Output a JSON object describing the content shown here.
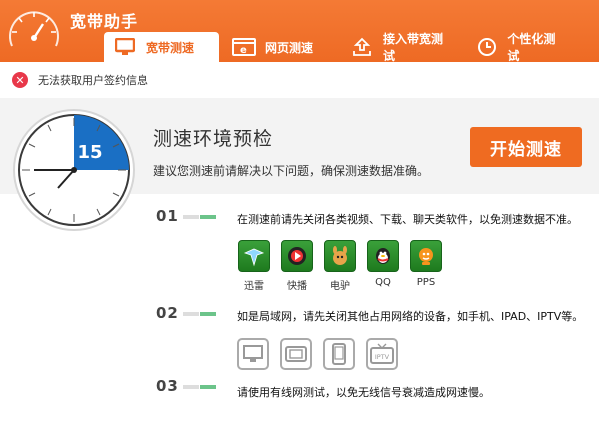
{
  "app": {
    "title": "宽带助手"
  },
  "tabs": [
    {
      "label": "宽带测速",
      "icon": "monitor-icon",
      "active": true
    },
    {
      "label": "网页测速",
      "icon": "browser-icon",
      "active": false
    },
    {
      "label": "接入带宽测试",
      "icon": "upload-icon",
      "active": false
    },
    {
      "label": "个性化测试",
      "icon": "clock-icon",
      "active": false
    }
  ],
  "notice": {
    "text": "无法获取用户签约信息",
    "icon": "error-icon"
  },
  "banner": {
    "title": "测速环境预检",
    "subtitle": "建议您测速前请解决以下问题，确保测速数据准确。",
    "start_button": "开始测速",
    "clock_value": "15"
  },
  "steps": [
    {
      "num": "01",
      "text": "在测速前请先关闭各类视频、下载、聊天类软件，以免测速数据不准。"
    },
    {
      "num": "02",
      "text": "如是局域网，请先关闭其他占用网络的设备，如手机、IPAD、IPTV等。"
    },
    {
      "num": "03",
      "text": "请使用有线网测试，以免无线信号衰减造成网速慢。"
    }
  ],
  "apps": [
    {
      "label": "迅雷",
      "icon": "xunlei-icon"
    },
    {
      "label": "快播",
      "icon": "kuaibo-icon"
    },
    {
      "label": "电驴",
      "icon": "edonkey-icon"
    },
    {
      "label": "QQ",
      "icon": "qq-icon"
    },
    {
      "label": "PPS",
      "icon": "pps-icon"
    }
  ],
  "devices": [
    {
      "icon": "monitor-device-icon"
    },
    {
      "icon": "tablet-device-icon"
    },
    {
      "icon": "phone-device-icon"
    },
    {
      "icon": "iptv-device-icon",
      "label": "IPTV"
    }
  ],
  "colors": {
    "accent": "#ee6a24",
    "clock_blue": "#1a6fc4",
    "step_green": "#6cc48a",
    "error": "#e8384a"
  }
}
